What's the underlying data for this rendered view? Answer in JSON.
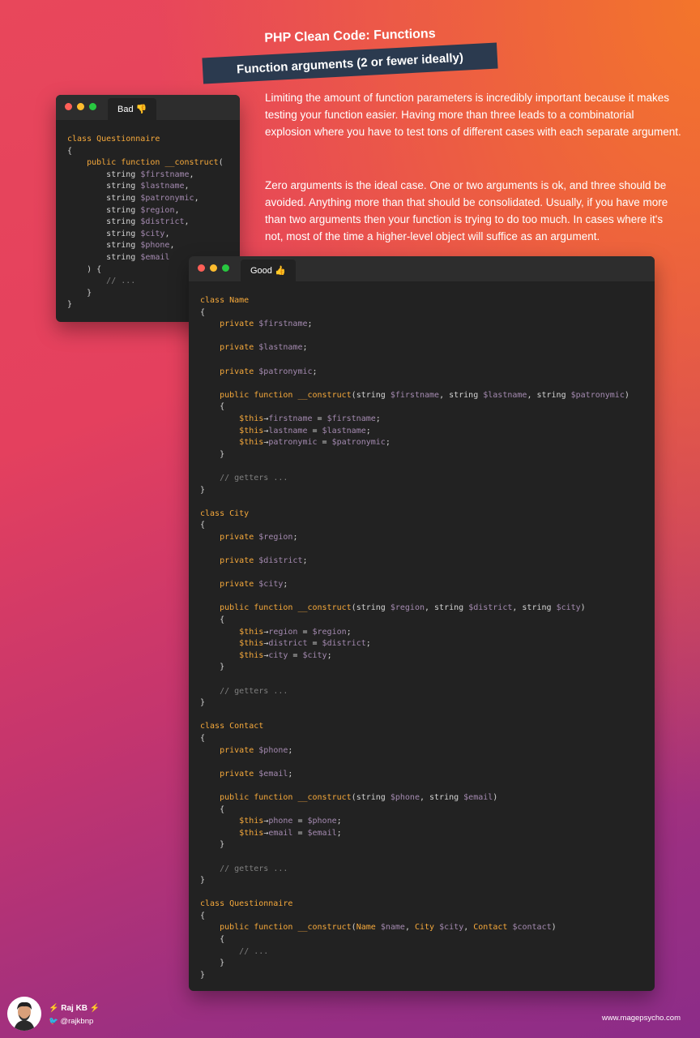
{
  "header": {
    "title": "PHP Clean Code: Functions",
    "subtitle": "Function arguments (2 or fewer ideally)"
  },
  "paragraphs": [
    "Limiting the amount of function parameters is incredibly important because it makes testing your function easier. Having more than three leads to a combinatorial explosion where you have to test tons of different cases with each separate argument.",
    "Zero arguments is the ideal case. One or two arguments is ok, and three should be avoided. Anything more than that should be consolidated. Usually, if you have more than two arguments then your function is trying to do too much. In cases where it's not, most of the time a higher-level object will suffice as an argument."
  ],
  "bad_window": {
    "tab_label": "Bad 👎",
    "code": [
      [
        [
          "kw",
          "class Questionnaire"
        ]
      ],
      [
        [
          "plain",
          "{"
        ]
      ],
      [
        [
          "plain",
          "    "
        ],
        [
          "kw",
          "public function"
        ],
        [
          "plain",
          " "
        ],
        [
          "kw",
          "__construct"
        ],
        [
          "plain",
          "("
        ]
      ],
      [
        [
          "plain",
          "        "
        ],
        [
          "plain",
          "string "
        ],
        [
          "var",
          "$firstname"
        ],
        [
          "plain",
          ","
        ]
      ],
      [
        [
          "plain",
          "        "
        ],
        [
          "plain",
          "string "
        ],
        [
          "var",
          "$lastname"
        ],
        [
          "plain",
          ","
        ]
      ],
      [
        [
          "plain",
          "        "
        ],
        [
          "plain",
          "string "
        ],
        [
          "var",
          "$patronymic"
        ],
        [
          "plain",
          ","
        ]
      ],
      [
        [
          "plain",
          "        "
        ],
        [
          "plain",
          "string "
        ],
        [
          "var",
          "$region"
        ],
        [
          "plain",
          ","
        ]
      ],
      [
        [
          "plain",
          "        "
        ],
        [
          "plain",
          "string "
        ],
        [
          "var",
          "$district"
        ],
        [
          "plain",
          ","
        ]
      ],
      [
        [
          "plain",
          "        "
        ],
        [
          "plain",
          "string "
        ],
        [
          "var",
          "$city"
        ],
        [
          "plain",
          ","
        ]
      ],
      [
        [
          "plain",
          "        "
        ],
        [
          "plain",
          "string "
        ],
        [
          "var",
          "$phone"
        ],
        [
          "plain",
          ","
        ]
      ],
      [
        [
          "plain",
          "        "
        ],
        [
          "plain",
          "string "
        ],
        [
          "var",
          "$email"
        ]
      ],
      [
        [
          "plain",
          "    ) {"
        ]
      ],
      [
        [
          "plain",
          "        "
        ],
        [
          "cm",
          "// ..."
        ]
      ],
      [
        [
          "plain",
          "    }"
        ]
      ],
      [
        [
          "plain",
          "}"
        ]
      ]
    ]
  },
  "good_window": {
    "tab_label": "Good 👍",
    "code": [
      [
        [
          "kw",
          "class Name"
        ]
      ],
      [
        [
          "plain",
          "{"
        ]
      ],
      [
        [
          "plain",
          "    "
        ],
        [
          "kw",
          "private"
        ],
        [
          "plain",
          " "
        ],
        [
          "var",
          "$firstname"
        ],
        [
          "plain",
          ";"
        ]
      ],
      [
        [
          "plain",
          ""
        ]
      ],
      [
        [
          "plain",
          "    "
        ],
        [
          "kw",
          "private"
        ],
        [
          "plain",
          " "
        ],
        [
          "var",
          "$lastname"
        ],
        [
          "plain",
          ";"
        ]
      ],
      [
        [
          "plain",
          ""
        ]
      ],
      [
        [
          "plain",
          "    "
        ],
        [
          "kw",
          "private"
        ],
        [
          "plain",
          " "
        ],
        [
          "var",
          "$patronymic"
        ],
        [
          "plain",
          ";"
        ]
      ],
      [
        [
          "plain",
          ""
        ]
      ],
      [
        [
          "plain",
          "    "
        ],
        [
          "kw",
          "public function"
        ],
        [
          "plain",
          " "
        ],
        [
          "kw",
          "__construct"
        ],
        [
          "plain",
          "(string "
        ],
        [
          "var",
          "$firstname"
        ],
        [
          "plain",
          ", string "
        ],
        [
          "var",
          "$lastname"
        ],
        [
          "plain",
          ", string "
        ],
        [
          "var",
          "$patronymic"
        ],
        [
          "plain",
          ")"
        ]
      ],
      [
        [
          "plain",
          "    {"
        ]
      ],
      [
        [
          "plain",
          "        "
        ],
        [
          "kw",
          "$this"
        ],
        [
          "plain",
          "→"
        ],
        [
          "var",
          "firstname"
        ],
        [
          "plain",
          " = "
        ],
        [
          "var",
          "$firstname"
        ],
        [
          "plain",
          ";"
        ]
      ],
      [
        [
          "plain",
          "        "
        ],
        [
          "kw",
          "$this"
        ],
        [
          "plain",
          "→"
        ],
        [
          "var",
          "lastname"
        ],
        [
          "plain",
          " = "
        ],
        [
          "var",
          "$lastname"
        ],
        [
          "plain",
          ";"
        ]
      ],
      [
        [
          "plain",
          "        "
        ],
        [
          "kw",
          "$this"
        ],
        [
          "plain",
          "→"
        ],
        [
          "var",
          "patronymic"
        ],
        [
          "plain",
          " = "
        ],
        [
          "var",
          "$patronymic"
        ],
        [
          "plain",
          ";"
        ]
      ],
      [
        [
          "plain",
          "    }"
        ]
      ],
      [
        [
          "plain",
          ""
        ]
      ],
      [
        [
          "plain",
          "    "
        ],
        [
          "cm",
          "// getters ..."
        ]
      ],
      [
        [
          "plain",
          "}"
        ]
      ],
      [
        [
          "plain",
          ""
        ]
      ],
      [
        [
          "kw",
          "class City"
        ]
      ],
      [
        [
          "plain",
          "{"
        ]
      ],
      [
        [
          "plain",
          "    "
        ],
        [
          "kw",
          "private"
        ],
        [
          "plain",
          " "
        ],
        [
          "var",
          "$region"
        ],
        [
          "plain",
          ";"
        ]
      ],
      [
        [
          "plain",
          ""
        ]
      ],
      [
        [
          "plain",
          "    "
        ],
        [
          "kw",
          "private"
        ],
        [
          "plain",
          " "
        ],
        [
          "var",
          "$district"
        ],
        [
          "plain",
          ";"
        ]
      ],
      [
        [
          "plain",
          ""
        ]
      ],
      [
        [
          "plain",
          "    "
        ],
        [
          "kw",
          "private"
        ],
        [
          "plain",
          " "
        ],
        [
          "var",
          "$city"
        ],
        [
          "plain",
          ";"
        ]
      ],
      [
        [
          "plain",
          ""
        ]
      ],
      [
        [
          "plain",
          "    "
        ],
        [
          "kw",
          "public function"
        ],
        [
          "plain",
          " "
        ],
        [
          "kw",
          "__construct"
        ],
        [
          "plain",
          "(string "
        ],
        [
          "var",
          "$region"
        ],
        [
          "plain",
          ", string "
        ],
        [
          "var",
          "$district"
        ],
        [
          "plain",
          ", string "
        ],
        [
          "var",
          "$city"
        ],
        [
          "plain",
          ")"
        ]
      ],
      [
        [
          "plain",
          "    {"
        ]
      ],
      [
        [
          "plain",
          "        "
        ],
        [
          "kw",
          "$this"
        ],
        [
          "plain",
          "→"
        ],
        [
          "var",
          "region"
        ],
        [
          "plain",
          " = "
        ],
        [
          "var",
          "$region"
        ],
        [
          "plain",
          ";"
        ]
      ],
      [
        [
          "plain",
          "        "
        ],
        [
          "kw",
          "$this"
        ],
        [
          "plain",
          "→"
        ],
        [
          "var",
          "district"
        ],
        [
          "plain",
          " = "
        ],
        [
          "var",
          "$district"
        ],
        [
          "plain",
          ";"
        ]
      ],
      [
        [
          "plain",
          "        "
        ],
        [
          "kw",
          "$this"
        ],
        [
          "plain",
          "→"
        ],
        [
          "var",
          "city"
        ],
        [
          "plain",
          " = "
        ],
        [
          "var",
          "$city"
        ],
        [
          "plain",
          ";"
        ]
      ],
      [
        [
          "plain",
          "    }"
        ]
      ],
      [
        [
          "plain",
          ""
        ]
      ],
      [
        [
          "plain",
          "    "
        ],
        [
          "cm",
          "// getters ..."
        ]
      ],
      [
        [
          "plain",
          "}"
        ]
      ],
      [
        [
          "plain",
          ""
        ]
      ],
      [
        [
          "kw",
          "class Contact"
        ]
      ],
      [
        [
          "plain",
          "{"
        ]
      ],
      [
        [
          "plain",
          "    "
        ],
        [
          "kw",
          "private"
        ],
        [
          "plain",
          " "
        ],
        [
          "var",
          "$phone"
        ],
        [
          "plain",
          ";"
        ]
      ],
      [
        [
          "plain",
          ""
        ]
      ],
      [
        [
          "plain",
          "    "
        ],
        [
          "kw",
          "private"
        ],
        [
          "plain",
          " "
        ],
        [
          "var",
          "$email"
        ],
        [
          "plain",
          ";"
        ]
      ],
      [
        [
          "plain",
          ""
        ]
      ],
      [
        [
          "plain",
          "    "
        ],
        [
          "kw",
          "public function"
        ],
        [
          "plain",
          " "
        ],
        [
          "kw",
          "__construct"
        ],
        [
          "plain",
          "(string "
        ],
        [
          "var",
          "$phone"
        ],
        [
          "plain",
          ", string "
        ],
        [
          "var",
          "$email"
        ],
        [
          "plain",
          ")"
        ]
      ],
      [
        [
          "plain",
          "    {"
        ]
      ],
      [
        [
          "plain",
          "        "
        ],
        [
          "kw",
          "$this"
        ],
        [
          "plain",
          "→"
        ],
        [
          "var",
          "phone"
        ],
        [
          "plain",
          " = "
        ],
        [
          "var",
          "$phone"
        ],
        [
          "plain",
          ";"
        ]
      ],
      [
        [
          "plain",
          "        "
        ],
        [
          "kw",
          "$this"
        ],
        [
          "plain",
          "→"
        ],
        [
          "var",
          "email"
        ],
        [
          "plain",
          " = "
        ],
        [
          "var",
          "$email"
        ],
        [
          "plain",
          ";"
        ]
      ],
      [
        [
          "plain",
          "    }"
        ]
      ],
      [
        [
          "plain",
          ""
        ]
      ],
      [
        [
          "plain",
          "    "
        ],
        [
          "cm",
          "// getters ..."
        ]
      ],
      [
        [
          "plain",
          "}"
        ]
      ],
      [
        [
          "plain",
          ""
        ]
      ],
      [
        [
          "kw",
          "class Questionnaire"
        ]
      ],
      [
        [
          "plain",
          "{"
        ]
      ],
      [
        [
          "plain",
          "    "
        ],
        [
          "kw",
          "public function"
        ],
        [
          "plain",
          " "
        ],
        [
          "kw",
          "__construct"
        ],
        [
          "plain",
          "("
        ],
        [
          "kw",
          "Name"
        ],
        [
          "plain",
          " "
        ],
        [
          "var",
          "$name"
        ],
        [
          "plain",
          ", "
        ],
        [
          "kw",
          "City"
        ],
        [
          "plain",
          " "
        ],
        [
          "var",
          "$city"
        ],
        [
          "plain",
          ", "
        ],
        [
          "kw",
          "Contact"
        ],
        [
          "plain",
          " "
        ],
        [
          "var",
          "$contact"
        ],
        [
          "plain",
          ")"
        ]
      ],
      [
        [
          "plain",
          "    {"
        ]
      ],
      [
        [
          "plain",
          "        "
        ],
        [
          "cm",
          "// ..."
        ]
      ],
      [
        [
          "plain",
          "    }"
        ]
      ],
      [
        [
          "plain",
          "}"
        ]
      ]
    ]
  },
  "footer": {
    "author": "Raj KB",
    "handle": "@rajkbnp",
    "website": "www.magepsycho.com",
    "icons": [
      "lightning-icon",
      "twitter-icon",
      "avatar"
    ]
  },
  "colors": {
    "keyword": "#f6a93b",
    "variable": "#a48ab0",
    "comment": "#7f7f7f",
    "code_bg": "#222222",
    "ribbon_bg": "#2b3a4f"
  }
}
